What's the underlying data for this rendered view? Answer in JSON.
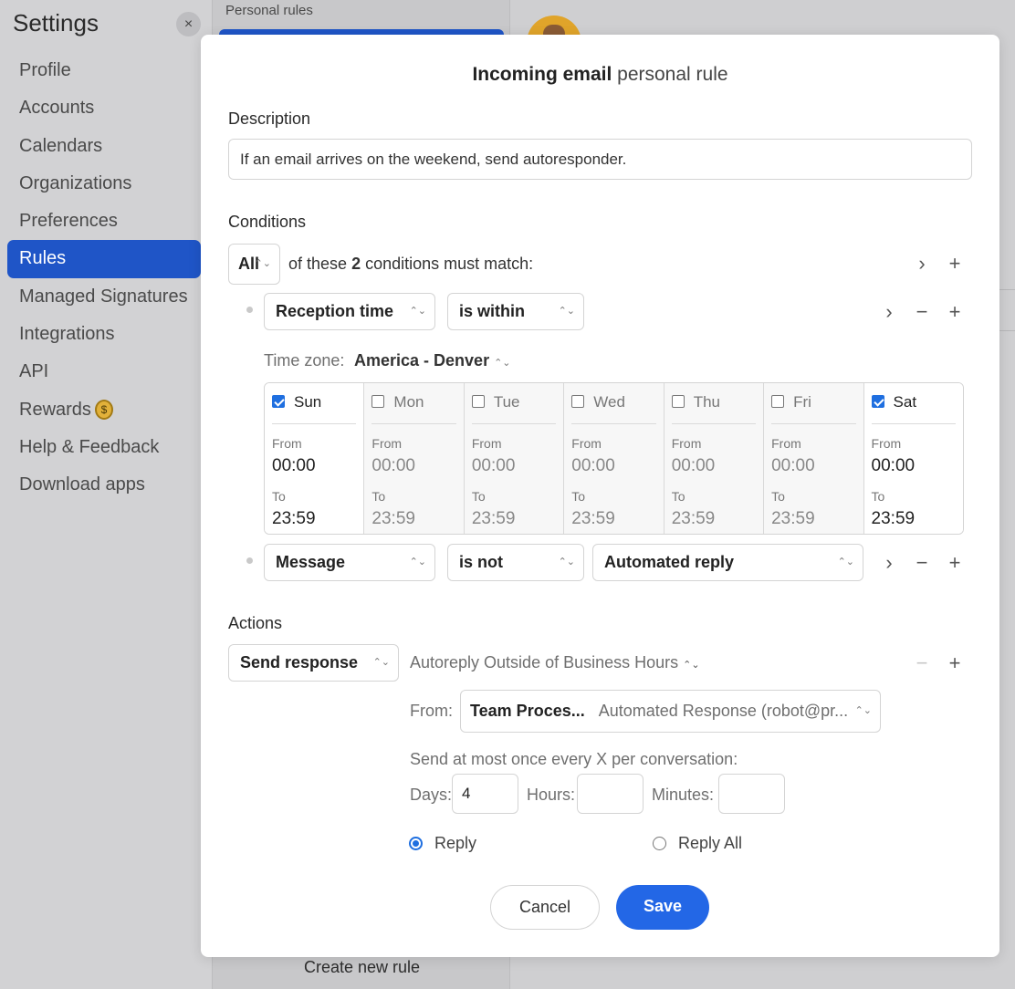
{
  "sidebar": {
    "title": "Settings",
    "close_icon": "×",
    "items": [
      {
        "label": "Profile"
      },
      {
        "label": "Accounts"
      },
      {
        "label": "Calendars"
      },
      {
        "label": "Organizations"
      },
      {
        "label": "Preferences"
      },
      {
        "label": "Rules",
        "active": true
      },
      {
        "label": "Managed Signatures"
      },
      {
        "label": "Integrations"
      },
      {
        "label": "API"
      },
      {
        "label": "Rewards",
        "icon": "money-bag-icon"
      },
      {
        "label": "Help & Feedback"
      },
      {
        "label": "Download apps"
      }
    ]
  },
  "middle": {
    "header": "Personal rules",
    "create_label": "Create new rule"
  },
  "modal": {
    "title_bold": "Incoming email",
    "title_rest": " personal rule",
    "description_label": "Description",
    "description_value": "If an email arrives on the weekend, send autoresponder.",
    "conditions_label": "Conditions",
    "match_select": "All",
    "match_text_pre": "of these",
    "match_count": "2",
    "match_text_post": "conditions must match:",
    "condition1": {
      "field": "Reception time",
      "operator": "is within"
    },
    "timezone_label": "Time zone:",
    "timezone_value": "America - Denver",
    "from_label": "From",
    "to_label": "To",
    "days": [
      {
        "name": "Sun",
        "checked": true,
        "from": "00:00",
        "to": "23:59"
      },
      {
        "name": "Mon",
        "checked": false,
        "from": "00:00",
        "to": "23:59"
      },
      {
        "name": "Tue",
        "checked": false,
        "from": "00:00",
        "to": "23:59"
      },
      {
        "name": "Wed",
        "checked": false,
        "from": "00:00",
        "to": "23:59"
      },
      {
        "name": "Thu",
        "checked": false,
        "from": "00:00",
        "to": "23:59"
      },
      {
        "name": "Fri",
        "checked": false,
        "from": "00:00",
        "to": "23:59"
      },
      {
        "name": "Sat",
        "checked": true,
        "from": "00:00",
        "to": "23:59"
      }
    ],
    "condition2": {
      "field": "Message",
      "operator": "is not",
      "value": "Automated reply"
    },
    "actions_label": "Actions",
    "action_select": "Send response",
    "template_value": "Autoreply Outside of Business Hours",
    "from_field_label": "From:",
    "sender_name": "Team Proces...",
    "sender_address": "Automated Response (robot@pr...",
    "frequency_label": "Send at most once every X per conversation:",
    "days_label": "Days:",
    "days_value": "4",
    "hours_label": "Hours:",
    "hours_value": "",
    "minutes_label": "Minutes:",
    "minutes_value": "",
    "reply_label": "Reply",
    "reply_all_label": "Reply All",
    "reply_selected": "Reply",
    "cancel_label": "Cancel",
    "save_label": "Save"
  },
  "colors": {
    "accent": "#2367e6",
    "nav_active": "#1f55c7"
  }
}
